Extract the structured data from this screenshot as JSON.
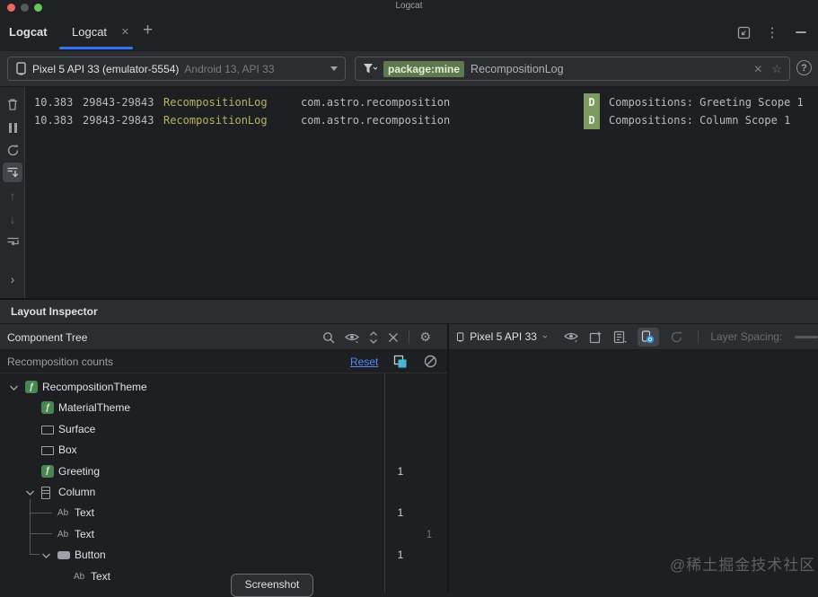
{
  "window": {
    "title": "Logcat"
  },
  "tabbar": {
    "tool_label": "Logcat",
    "tab_label": "Logcat",
    "close_glyph": "✕",
    "plus_glyph": "+"
  },
  "toolbar": {
    "device_name": "Pixel 5 API 33 (emulator-5554)",
    "device_detail": "Android 13, API 33",
    "filter_chip": "package:mine",
    "filter_query": "RecompositionLog",
    "clear_glyph": "✕",
    "star_glyph": "☆",
    "help_glyph": "?"
  },
  "logcat": {
    "rows": [
      {
        "time": "10.383",
        "pid": "29843-29843",
        "tag": "RecompositionLog",
        "package": "com.astro.recomposition",
        "level": "D",
        "message": "Compositions: Greeting Scope 1"
      },
      {
        "time": "10.383",
        "pid": "29843-29843",
        "tag": "RecompositionLog",
        "package": "com.astro.recomposition",
        "level": "D",
        "message": "Compositions: Column Scope 1"
      }
    ]
  },
  "inspector": {
    "title": "Layout Inspector",
    "tree_panel_header": "Component Tree",
    "counts_label": "Recomposition counts",
    "reset_label": "Reset",
    "tree": [
      {
        "label": "RecompositionTheme",
        "icon": "compose",
        "depth": 0,
        "chevron": true
      },
      {
        "label": "MaterialTheme",
        "icon": "compose",
        "depth": 1
      },
      {
        "label": "Surface",
        "icon": "rect",
        "depth": 1
      },
      {
        "label": "Box",
        "icon": "rect",
        "depth": 1
      },
      {
        "label": "Greeting",
        "icon": "compose",
        "depth": 1,
        "count": "1"
      },
      {
        "label": "Column",
        "icon": "column",
        "depth": 1,
        "chevron": true
      },
      {
        "label": "Text",
        "icon": "ab",
        "depth": 2,
        "count": "1"
      },
      {
        "label": "Text",
        "icon": "ab",
        "depth": 2,
        "skip": "1"
      },
      {
        "label": "Button",
        "icon": "button",
        "depth": 2,
        "chevron": true,
        "count": "1"
      },
      {
        "label": "Text",
        "icon": "ab",
        "depth": 3
      }
    ],
    "right_panel": {
      "device": "Pixel 5 API 33",
      "layer_spacing_label": "Layer Spacing:"
    }
  },
  "tooltip_label": "Screenshot",
  "watermark": "@稀土掘金技术社区",
  "colors": {
    "accent_blue": "#3574f0",
    "link_blue": "#548af7",
    "tag_yellow": "#b8b45c",
    "badge_green": "#7d9b60",
    "chip_green": "#5e7850",
    "layers_cyan": "#45b8d8"
  }
}
